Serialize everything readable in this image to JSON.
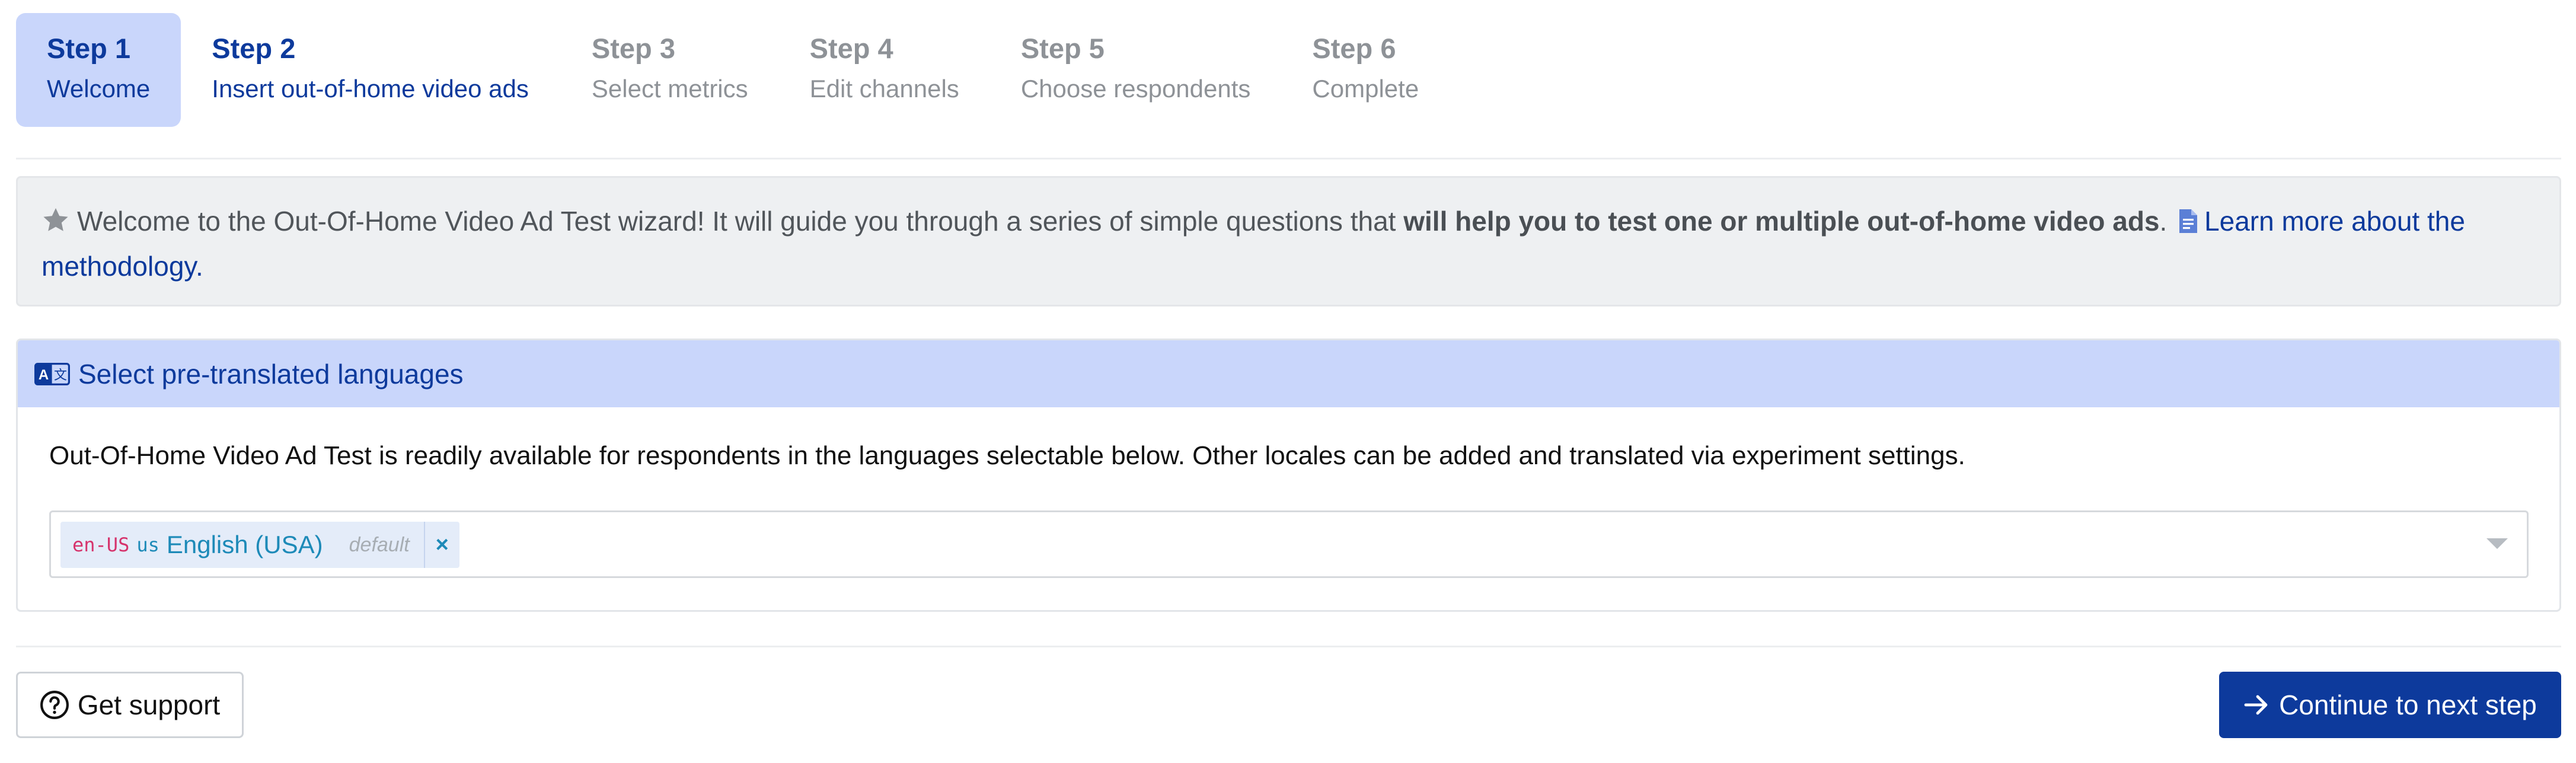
{
  "steps": [
    {
      "num": "Step 1",
      "label": "Welcome"
    },
    {
      "num": "Step 2",
      "label": "Insert out-of-home video ads"
    },
    {
      "num": "Step 3",
      "label": "Select metrics"
    },
    {
      "num": "Step 4",
      "label": "Edit channels"
    },
    {
      "num": "Step 5",
      "label": "Choose respondents"
    },
    {
      "num": "Step 6",
      "label": "Complete"
    }
  ],
  "info": {
    "icon": "star-icon",
    "intro": "Welcome to the Out-Of-Home Video Ad Test wizard! It will guide you through a series of simple questions that ",
    "bold": "will help you to test one or multiple out-of-home video ads",
    "after_bold": ". ",
    "link_icon": "document-icon",
    "link_text": "Learn more about the methodology."
  },
  "languages": {
    "header_icon": "translate-icon",
    "header": "Select pre-translated languages",
    "description": "Out-Of-Home Video Ad Test is readily available for respondents in the languages selectable below. Other locales can be added and translated via experiment settings.",
    "selected": {
      "code": "en-US",
      "flag": "us",
      "name": "English (USA)",
      "badge": "default",
      "remove": "×"
    }
  },
  "buttons": {
    "support": "Get support",
    "support_icon": "question-circle-icon",
    "next": "Continue to next step",
    "next_icon": "arrow-right-icon"
  },
  "colors": {
    "primary": "#0d3a9c",
    "active_step_bg": "#c9d6fb",
    "info_bg": "#eef0f2"
  }
}
